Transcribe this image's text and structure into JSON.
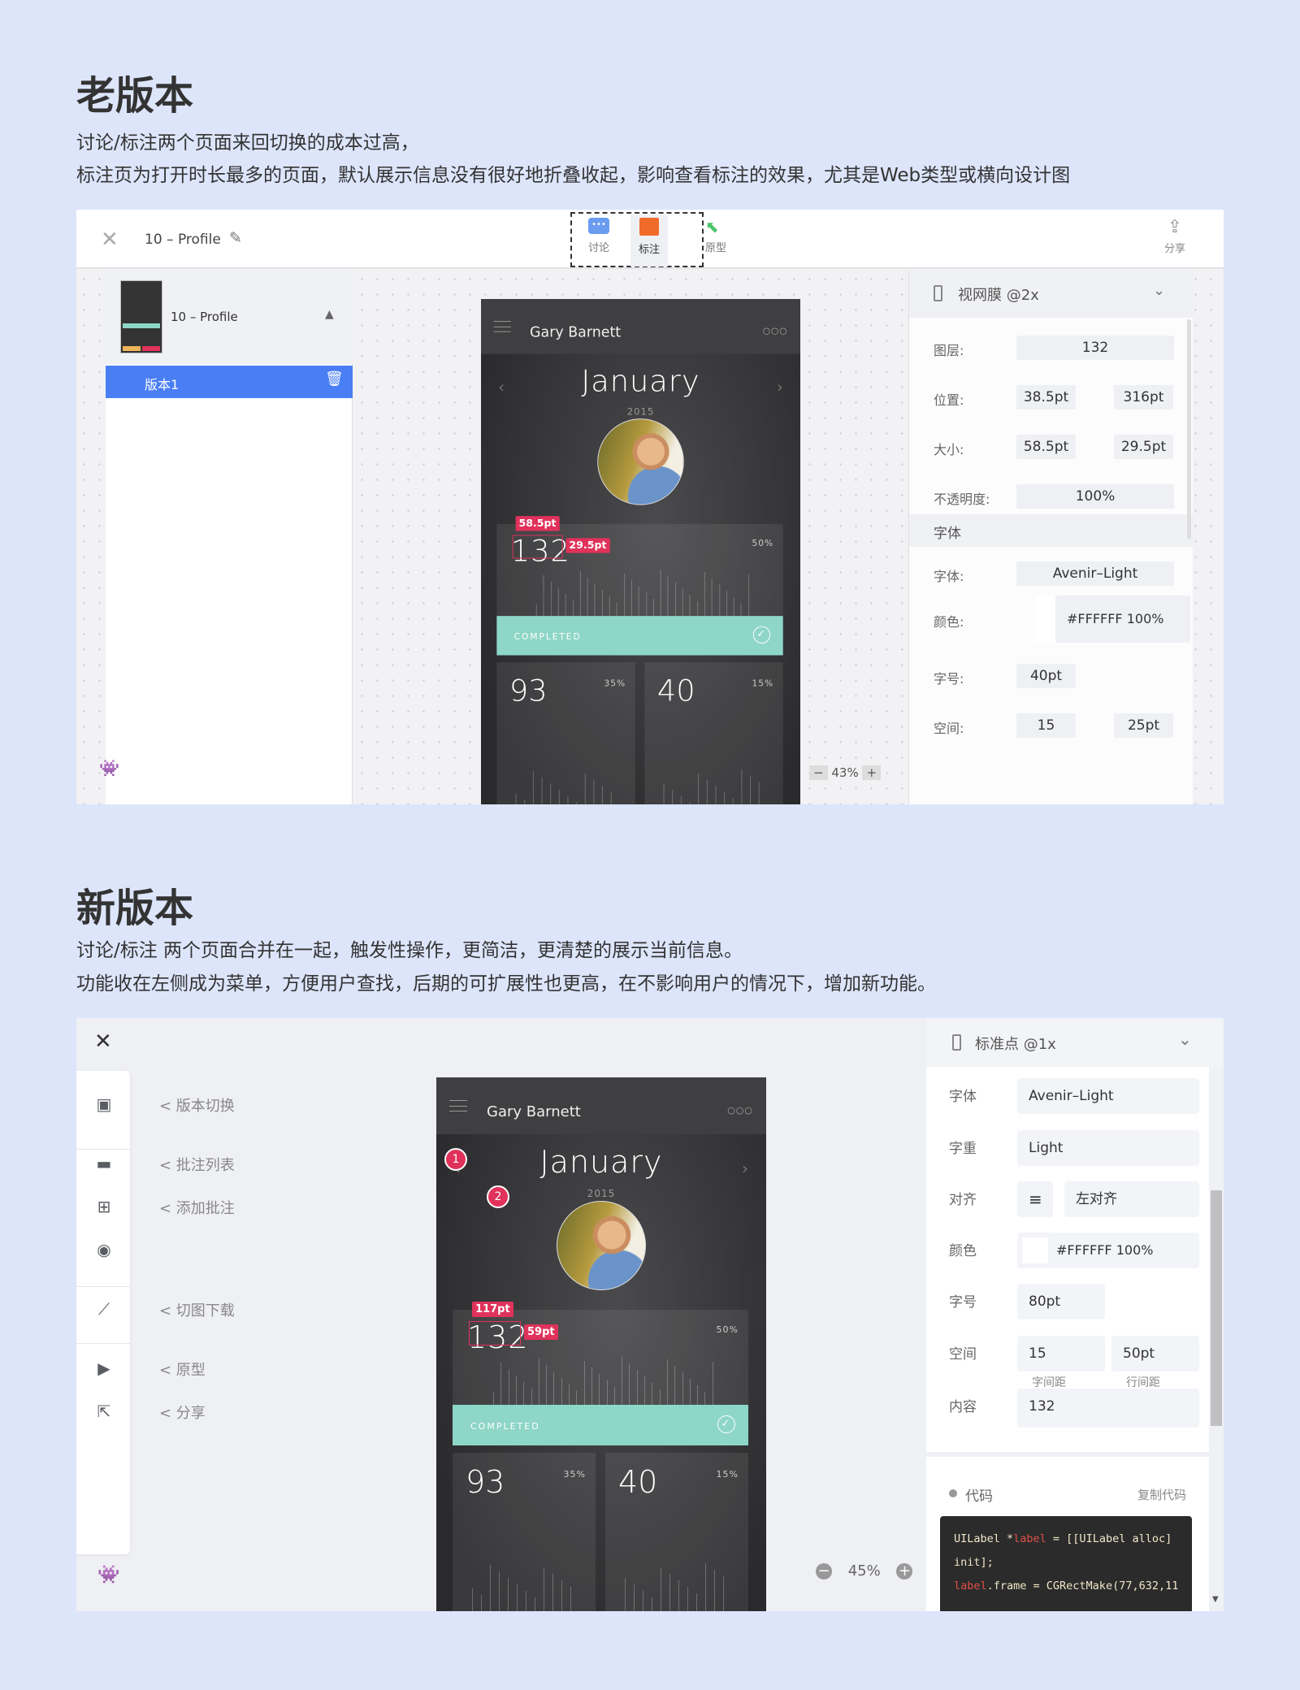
{
  "old": {
    "heading": "老版本",
    "desc": [
      "讨论/标注两个页面来回切换的成本过高，",
      "标注页为打开时长最多的页面，默认展示信息没有很好地折叠收起，影响查看标注的效果，尤其是Web类型或横向设计图"
    ],
    "topbar": {
      "title": "10 – Profile",
      "tabs": [
        {
          "label": "讨论",
          "icon": "chat-bubble-icon",
          "color": "#6a9cf0"
        },
        {
          "label": "标注",
          "icon": "annotate-image-icon",
          "color": "#f06a2a",
          "active": true
        },
        {
          "label": "原型",
          "icon": "cursor-icon",
          "color": "#4cc46a"
        }
      ],
      "share": "分享"
    },
    "pages": {
      "item": "10 – Profile",
      "version": "版本1"
    },
    "zoom": "43%",
    "inspector": {
      "device": "视网膜 @2x",
      "rows": [
        {
          "label": "图层:",
          "values": [
            "132"
          ]
        },
        {
          "label": "位置:",
          "values": [
            "38.5pt",
            "316pt"
          ]
        },
        {
          "label": "大小:",
          "values": [
            "58.5pt",
            "29.5pt"
          ]
        },
        {
          "label": "不透明度:",
          "values": [
            "100%"
          ]
        }
      ],
      "section": "字体",
      "font_rows": [
        {
          "label": "字体:",
          "values": [
            "Avenir–Light"
          ]
        },
        {
          "label": "颜色:",
          "values": [
            "#FFFFFF 100%"
          ]
        },
        {
          "label": "字号:",
          "values": [
            "40pt"
          ]
        },
        {
          "label": "空间:",
          "values": [
            "15",
            "25pt"
          ]
        }
      ]
    },
    "measure": {
      "w": "58.5pt",
      "h": "29.5pt"
    }
  },
  "new": {
    "heading": "新版本",
    "desc": [
      "讨论/标注 两个页面合并在一起，触发性操作，更简洁，更清楚的展示当前信息。",
      "功能收在左侧成为菜单，方便用户查找，后期的可扩展性也更高，在不影响用户的情况下，增加新功能。"
    ],
    "menu": [
      {
        "label": "< 版本切换",
        "icon": "version-image-icon"
      },
      {
        "label": "< 批注列表",
        "icon": "comment-list-icon"
      },
      {
        "label": "< 添加批注",
        "icon": "add-comment-icon"
      },
      {
        "label": "",
        "icon": "eye-icon"
      },
      {
        "label": "< 切图下载",
        "icon": "knife-icon"
      },
      {
        "label": "< 原型",
        "icon": "prototype-icon"
      },
      {
        "label": "< 分享",
        "icon": "share-icon"
      }
    ],
    "zoom": "45%",
    "pins": [
      "1",
      "2"
    ],
    "measure": {
      "w": "117pt",
      "h": "59pt"
    },
    "inspector": {
      "device": "标准点 @1x",
      "font": {
        "label": "字体",
        "value": "Avenir–Light"
      },
      "weight": {
        "label": "字重",
        "value": "Light"
      },
      "align": {
        "label": "对齐",
        "value": "左对齐"
      },
      "color": {
        "label": "颜色",
        "value": "#FFFFFF 100%"
      },
      "size": {
        "label": "字号",
        "value": "80pt"
      },
      "spacing": {
        "label": "空间",
        "values": [
          "15",
          "50pt"
        ],
        "sub": [
          "字间距",
          "行间距"
        ]
      },
      "content": {
        "label": "内容",
        "value": "132"
      },
      "code": {
        "title": "代码",
        "copy": "复制代码",
        "lines": [
          [
            "UILabel *",
            "label",
            " = [[UILabel alloc]"
          ],
          [
            "init];"
          ],
          [
            "",
            "label",
            ".frame = CGRectMake(77,632,11"
          ]
        ]
      }
    }
  },
  "phone": {
    "name": "Gary Barnett",
    "month": "January",
    "year": "2015",
    "main_value": "132",
    "main_pct": "50%",
    "completed": "COMPLETED",
    "card2_value": "93",
    "card2_pct": "35%",
    "card3_value": "40",
    "card3_pct": "15%"
  },
  "colors": {
    "accent": "#4a7ef5",
    "pink": "#e0325a",
    "teal": "#8ed6c7",
    "orange": "#f0b45a"
  }
}
